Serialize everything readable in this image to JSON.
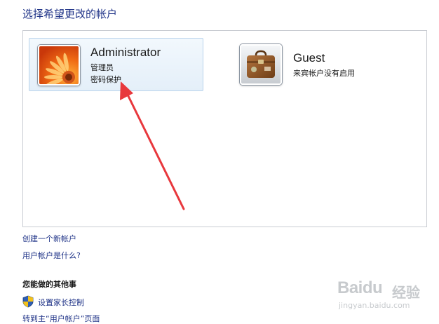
{
  "page": {
    "title": "选择希望更改的帐户"
  },
  "accounts": [
    {
      "name": "Administrator",
      "line1": "管理员",
      "line2": "密码保护",
      "avatar_icon": "flower-avatar-icon",
      "selected": true
    },
    {
      "name": "Guest",
      "line1": "来宾帐户没有启用",
      "avatar_icon": "briefcase-avatar-icon",
      "selected": false
    }
  ],
  "links": {
    "create_account": "创建一个新帐户",
    "what_is_account": "用户帐户是什么?"
  },
  "other_tasks": {
    "heading": "您能做的其他事",
    "parental_controls": "设置家长控制",
    "parental_controls_icon": "uac-shield-icon",
    "go_main": "转到主“用户帐户”页面"
  },
  "watermark": {
    "logo": "Baidu",
    "cn": "经验",
    "url": "jingyan.baidu.com"
  },
  "colors": {
    "link": "#1e3287",
    "annotation_arrow": "#e8383d",
    "selected_tile": "#e4eff9"
  }
}
